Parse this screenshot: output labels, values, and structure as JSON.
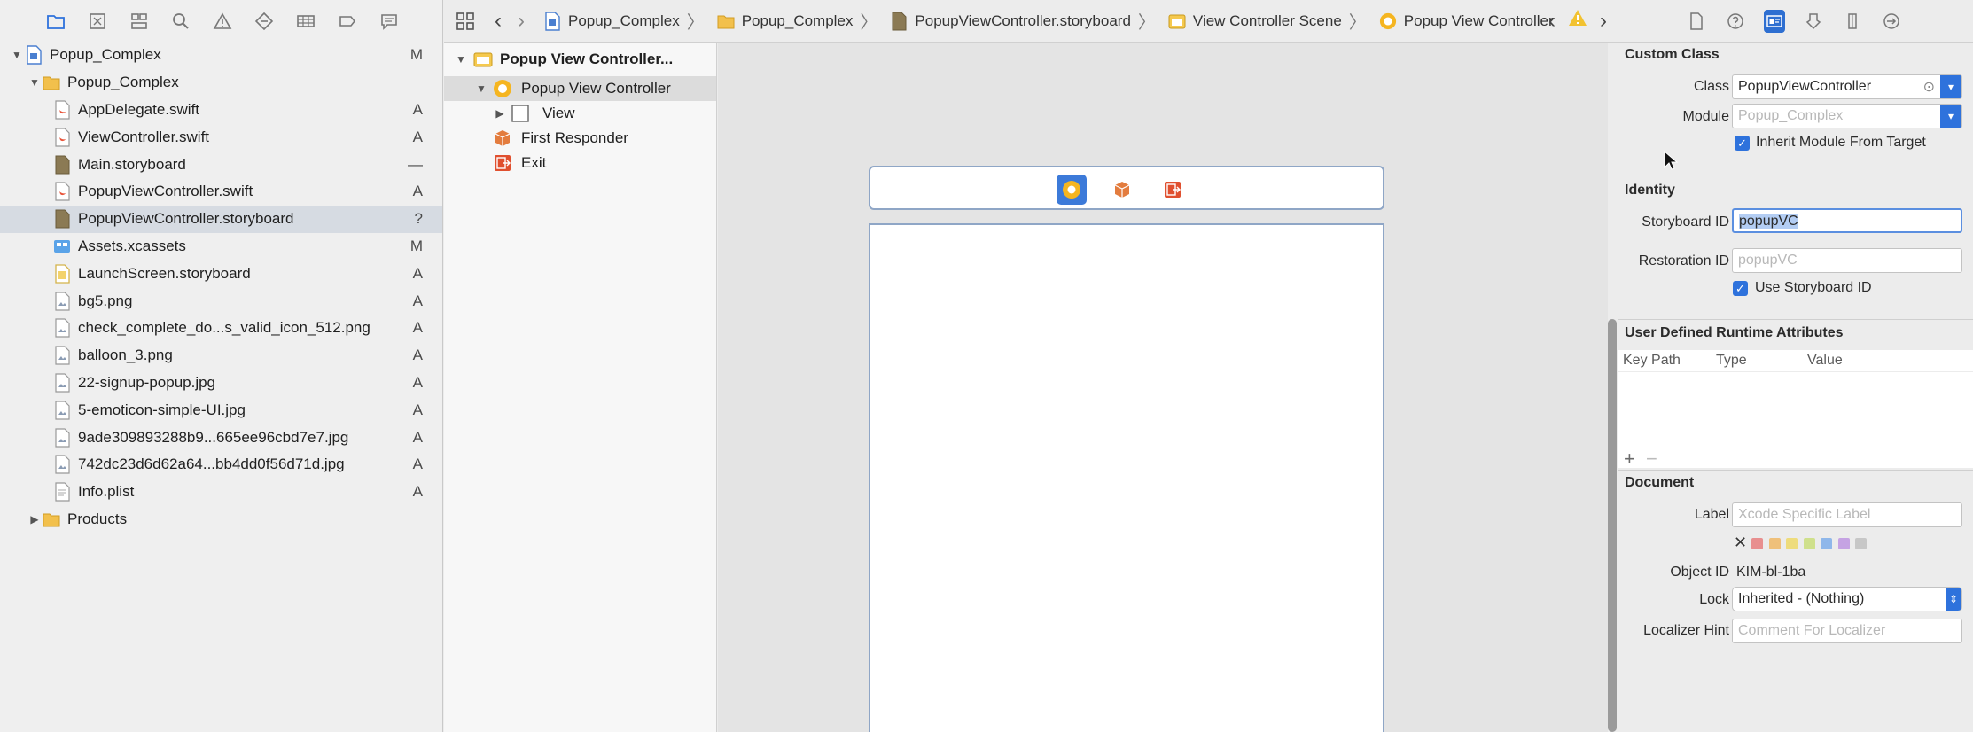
{
  "navigator": {
    "items": [
      {
        "label": "Popup_Complex",
        "status": "M",
        "indent": 0,
        "kind": "project",
        "disclosure": "open"
      },
      {
        "label": "Popup_Complex",
        "status": "",
        "indent": 1,
        "kind": "folder",
        "disclosure": "open"
      },
      {
        "label": "AppDelegate.swift",
        "status": "A",
        "indent": 2,
        "kind": "swift"
      },
      {
        "label": "ViewController.swift",
        "status": "A",
        "indent": 2,
        "kind": "swift"
      },
      {
        "label": "Main.storyboard",
        "status": "—",
        "indent": 2,
        "kind": "storyboard"
      },
      {
        "label": "PopupViewController.swift",
        "status": "A",
        "indent": 2,
        "kind": "swift"
      },
      {
        "label": "PopupViewController.storyboard",
        "status": "?",
        "indent": 2,
        "kind": "storyboard",
        "selected": true
      },
      {
        "label": "Assets.xcassets",
        "status": "M",
        "indent": 2,
        "kind": "assets"
      },
      {
        "label": "LaunchScreen.storyboard",
        "status": "A",
        "indent": 2,
        "kind": "launch"
      },
      {
        "label": "bg5.png",
        "status": "A",
        "indent": 2,
        "kind": "image"
      },
      {
        "label": "check_complete_do...s_valid_icon_512.png",
        "status": "A",
        "indent": 2,
        "kind": "image"
      },
      {
        "label": "balloon_3.png",
        "status": "A",
        "indent": 2,
        "kind": "image"
      },
      {
        "label": "22-signup-popup.jpg",
        "status": "A",
        "indent": 2,
        "kind": "image"
      },
      {
        "label": "5-emoticon-simple-UI.jpg",
        "status": "A",
        "indent": 2,
        "kind": "image"
      },
      {
        "label": "9ade309893288b9...665ee96cbd7e7.jpg",
        "status": "A",
        "indent": 2,
        "kind": "image"
      },
      {
        "label": "742dc23d6d62a64...bb4dd0f56d71d.jpg",
        "status": "A",
        "indent": 2,
        "kind": "image"
      },
      {
        "label": "Info.plist",
        "status": "A",
        "indent": 2,
        "kind": "plist"
      },
      {
        "label": "Products",
        "status": "",
        "indent": 1,
        "kind": "folder",
        "disclosure": "closed"
      }
    ]
  },
  "jumpbar": {
    "crumbs": [
      "Popup_Complex",
      "Popup_Complex",
      "PopupViewController.storyboard",
      "View Controller Scene",
      "Popup View Controller"
    ]
  },
  "outline": {
    "scene": "Popup View Controller...",
    "controller": "Popup View Controller",
    "view": "View",
    "first_responder": "First Responder",
    "exit": "Exit"
  },
  "inspector": {
    "custom_class": {
      "title": "Custom Class",
      "class_label": "Class",
      "class_value": "PopupViewController",
      "module_label": "Module",
      "module_placeholder": "Popup_Complex",
      "inherit_label": "Inherit Module From Target"
    },
    "identity": {
      "title": "Identity",
      "storyboard_id_label": "Storyboard ID",
      "storyboard_id_value": "popupVC",
      "restoration_id_label": "Restoration ID",
      "restoration_id_placeholder": "popupVC",
      "use_storyboard_label": "Use Storyboard ID"
    },
    "runtime_attrs": {
      "title": "User Defined Runtime Attributes",
      "col_key": "Key Path",
      "col_type": "Type",
      "col_value": "Value",
      "add": "+",
      "remove": "−"
    },
    "document": {
      "title": "Document",
      "label_label": "Label",
      "label_placeholder": "Xcode Specific Label",
      "clear_mark": "✕",
      "object_id_label": "Object ID",
      "object_id_value": "KIM-bl-1ba",
      "lock_label": "Lock",
      "lock_value": "Inherited - (Nothing)",
      "localizer_label": "Localizer Hint",
      "localizer_placeholder": "Comment For Localizer"
    },
    "label_colors": [
      "#e88f8f",
      "#efc07a",
      "#eedc7c",
      "#cfe08c",
      "#8fb7ea",
      "#c5a3e3",
      "#c7c7c7"
    ]
  }
}
